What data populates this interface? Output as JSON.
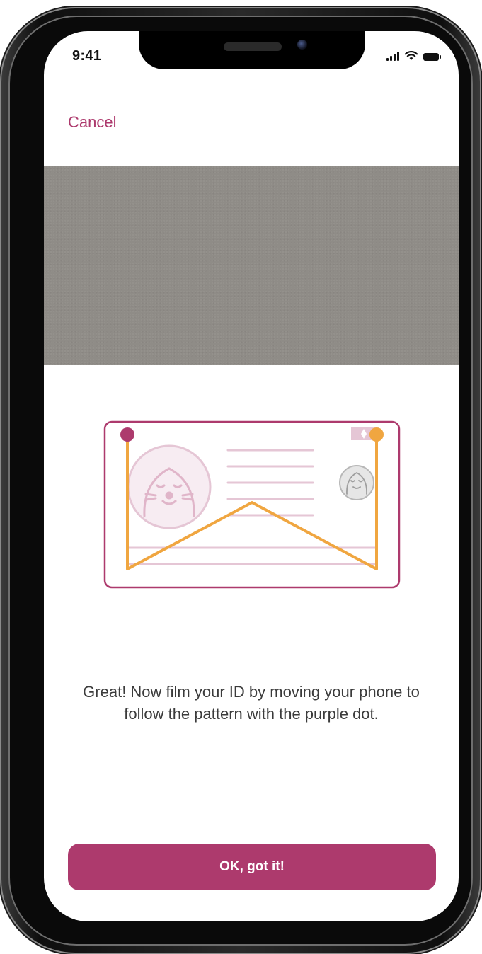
{
  "status_bar": {
    "time": "9:41",
    "icons": [
      "signal-icon",
      "wifi-icon",
      "battery-icon"
    ]
  },
  "header": {
    "cancel_label": "Cancel"
  },
  "main": {
    "instruction": "Great! Now film your ID by moving your phone to follow the pattern with the purple dot.",
    "confirm_label": "OK, got it!"
  },
  "illustration": {
    "type": "id-card-scan-pattern",
    "colors": {
      "card_border": "#ad3a6d",
      "card_lines": "#e5c6d5",
      "path": "#f0a640",
      "start_dot": "#ad3a6d",
      "end_dot": "#f0a640",
      "hologram_face": "#b7b7b7"
    }
  },
  "colors": {
    "accent": "#ad3a6d",
    "camera_preview": "#8f8c87",
    "text": "#3b3b3b",
    "background": "#ffffff"
  }
}
